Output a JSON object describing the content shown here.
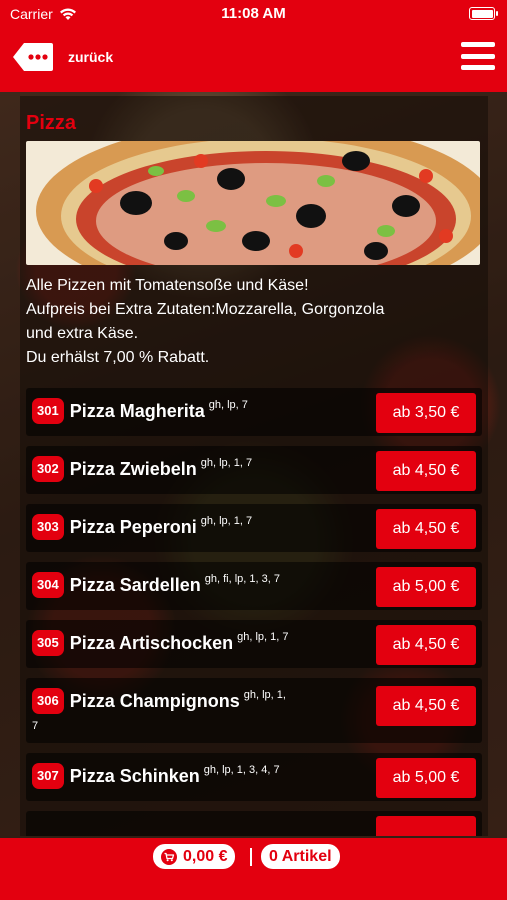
{
  "status_bar": {
    "carrier": "Carrier",
    "time": "11:08 AM"
  },
  "header": {
    "back_label": "zurück"
  },
  "category": {
    "title": "Pizza",
    "description": [
      "Alle Pizzen mit Tomatensoße und Käse!",
      "Aufpreis bei Extra Zutaten:Mozzarella, Gorgonzola",
      "und extra Käse.",
      "Du erhälst 7,00 % Rabatt."
    ]
  },
  "items": [
    {
      "nr": "301",
      "name": "Pizza Magherita",
      "allergens": "gh, lp, 7",
      "price": "ab 3,50 €"
    },
    {
      "nr": "302",
      "name": "Pizza Zwiebeln",
      "allergens": "gh, lp, 1, 7",
      "price": "ab 4,50 €"
    },
    {
      "nr": "303",
      "name": "Pizza Peperoni",
      "allergens": "gh, lp, 1, 7",
      "price": "ab 4,50 €"
    },
    {
      "nr": "304",
      "name": "Pizza Sardellen",
      "allergens": "gh, fi, lp, 1, 3, 7",
      "price": "ab 5,00 €"
    },
    {
      "nr": "305",
      "name": "Pizza Artischocken",
      "allergens": "gh, lp, 1, 7",
      "price": "ab 4,50 €"
    },
    {
      "nr": "306",
      "name": "Pizza Champignons",
      "allergens": "gh, lp, 1,",
      "allergens_wrap": "7",
      "price": "ab 4,50 €"
    },
    {
      "nr": "307",
      "name": "Pizza Schinken",
      "allergens": "gh, lp, 1, 3, 4, 7",
      "price": "ab 5,00 €"
    }
  ],
  "cart": {
    "total": "0,00 €",
    "count": "0 Artikel"
  },
  "colors": {
    "brand_red": "#e3000f"
  }
}
